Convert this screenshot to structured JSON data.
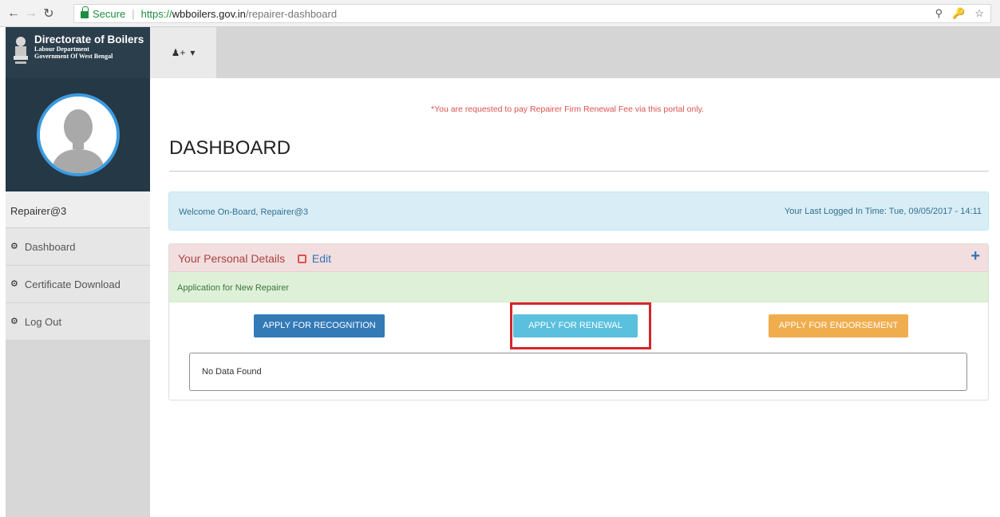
{
  "browser": {
    "secure_label": "Secure",
    "url_scheme": "https://",
    "url_host": "wbboilers.gov.in",
    "url_path": "/repairer-dashboard"
  },
  "brand": {
    "title": "Directorate of Boilers",
    "dept": "Labour Department",
    "govt": "Government Of West Bengal"
  },
  "sidebar": {
    "username": "Repairer@3",
    "items": [
      {
        "label": "Dashboard",
        "icon": "dashboard-icon"
      },
      {
        "label": "Certificate Download",
        "icon": "dashboard-icon"
      },
      {
        "label": "Log Out",
        "icon": "dashboard-icon"
      }
    ]
  },
  "topbar": {
    "user_menu_icon": "user-add-icon"
  },
  "notice": "*You are requested to pay Repairer Firm Renewal Fee via this portal only.",
  "page_title": "DASHBOARD",
  "welcome": {
    "message": "Welcome On-Board, Repairer@3",
    "last_login": "Your Last Logged In Time: Tue, 09/05/2017 - 14:11"
  },
  "personal_details": {
    "title": "Your Personal Details",
    "edit_label": "Edit"
  },
  "application": {
    "title": "Application for New Repairer",
    "buttons": {
      "recognition": "APPLY FOR RECOGNITION",
      "renewal": "APPLY FOR RENEWAL",
      "endorsement": "APPLY FOR ENDORSEMENT"
    },
    "empty_message": "No Data Found"
  },
  "colors": {
    "highlight": "#d4262d",
    "sidebar_dark": "#2b3e4c",
    "avatar_ring": "#3b9be0"
  }
}
